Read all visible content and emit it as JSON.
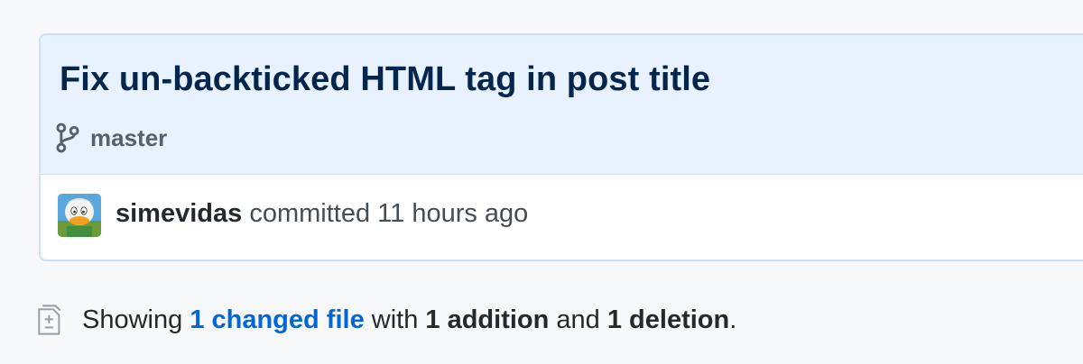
{
  "commit": {
    "title": "Fix un-backticked HTML tag in post title",
    "branch": "master",
    "author": "simevidas",
    "action": "committed",
    "time": "11 hours ago"
  },
  "summary": {
    "prefix": "Showing",
    "changed_files_link": "1 changed file",
    "with": "with",
    "additions": "1 addition",
    "and": "and",
    "deletions": "1 deletion",
    "period": "."
  },
  "icons": {
    "branch": "git-branch-icon",
    "diff": "file-diff-icon",
    "avatar": "user-avatar"
  },
  "colors": {
    "header_bg": "#e8f2fe",
    "border": "#c8e1ff",
    "title": "#05264c",
    "link": "#0366d6",
    "muted": "#586069"
  }
}
